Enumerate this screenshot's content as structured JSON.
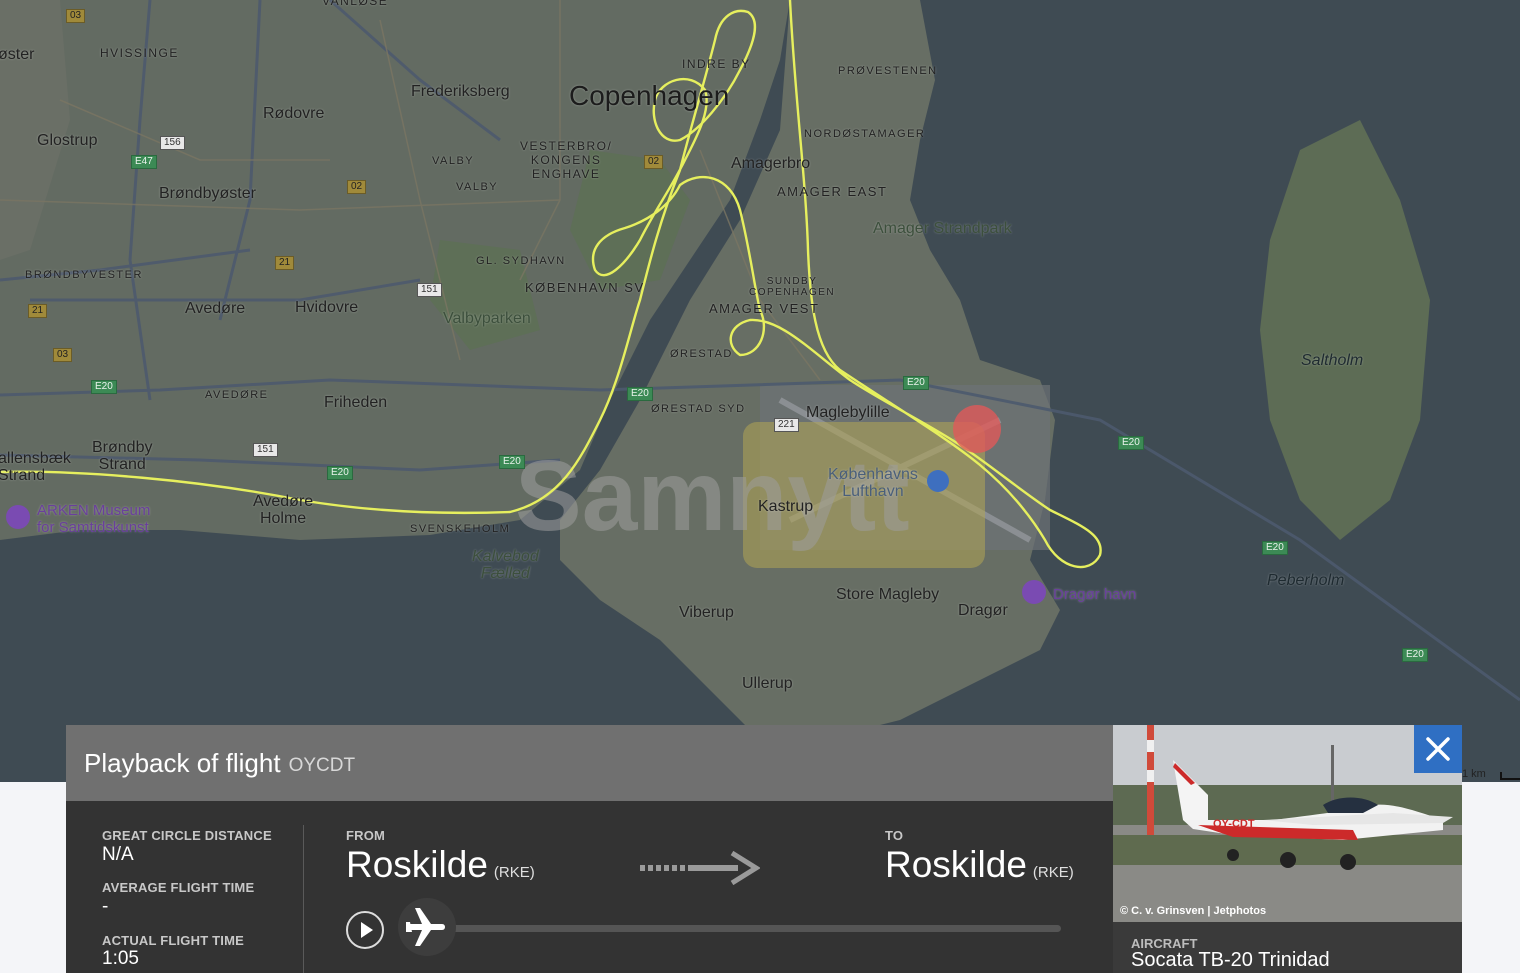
{
  "map": {
    "labels": {
      "vanlose": "VANLØSE",
      "oster": "øster",
      "hvissinge": "HVISSINGE",
      "glostrup": "Glostrup",
      "rodovre": "Rødovre",
      "frederiksberg": "Frederiksberg",
      "copenhagen": "Copenhagen",
      "indre_by": "INDRE BY",
      "provestenen": "PRØVESTENEN",
      "nordostamager": "NORDØSTAMAGER",
      "vesterbro": "VESTERBRO/\nKONGENS\nENGHAVE",
      "valby1": "VALBY",
      "valby2": "VALBY",
      "amagerbro": "Amagerbro",
      "amager_east": "AMAGER EAST",
      "amager_strandpark": "Amager Strandpark",
      "brondbyoster": "Brøndbyøster",
      "brondbyvester": "BRØNDBYVESTER",
      "sydhavn": "GL. SYDHAVN",
      "kobenhavn_sv": "KØBENHAVN SV",
      "sundby": "SUNDBY\nCOPENHAGEN",
      "amager_vest": "AMAGER VEST",
      "avedore1": "Avedøre",
      "hvidovre": "Hvidovre",
      "valbyparken": "Valbyparken",
      "orestad": "ØRESTAD",
      "avedore2": "AVEDØRE",
      "friheden": "Friheden",
      "orestad_syd": "ØRESTAD SYD",
      "maglebylille": "Maglebylille",
      "brondby_strand": "Brøndby\nStrand",
      "allensbaek": "allensbæk\nStrand",
      "kobenhavns_lufthavn": "Københavns\nLufthavn",
      "kastrup": "Kastrup",
      "avedore_holme": "Avedøre\nHolme",
      "arken": "ARKEN Museum\nfor Samtidskunst",
      "svenskeholm": "SVENSKEHOLM",
      "kalvebod": "Kalvebod\nFælled",
      "viberup": "Viberup",
      "store_magleby": "Store Magleby",
      "dragor": "Dragør",
      "dragor_havn": "Dragør havn",
      "saltholm": "Saltholm",
      "peberholm": "Peberholm",
      "ullerup": "Ullerup"
    },
    "shields": [
      "03",
      "156",
      "E47",
      "02",
      "02",
      "21",
      "151",
      "21",
      "03",
      "E20",
      "151",
      "E20",
      "E20",
      "E20",
      "E20",
      "221",
      "E20",
      "E20",
      "E20",
      "E20"
    ],
    "watermark": "Samnytt",
    "scale": "1 km",
    "colors": {
      "track": "#e6ef5e",
      "land": "#626a60",
      "water": "#3f4b53"
    }
  },
  "panel": {
    "title": "Playback of flight",
    "registration": "OYCDT",
    "great_circle_label": "GREAT CIRCLE DISTANCE",
    "great_circle_value": "N/A",
    "avg_time_label": "AVERAGE FLIGHT TIME",
    "avg_time_value": "-",
    "actual_time_label": "ACTUAL FLIGHT TIME",
    "actual_time_value": "1:05",
    "from_label": "FROM",
    "from_city": "Roskilde",
    "from_code": "(RKE)",
    "to_label": "TO",
    "to_city": "Roskilde",
    "to_code": "(RKE)",
    "progress": 0.0,
    "icons": [
      "play-icon",
      "airplane-icon",
      "arrow-right-icon"
    ]
  },
  "photo": {
    "credit": "© C. v. Grinsven | Jetphotos",
    "aircraft_label": "AIRCRAFT",
    "aircraft_value": "Socata TB-20 Trinidad",
    "close_icon": "close-icon"
  }
}
